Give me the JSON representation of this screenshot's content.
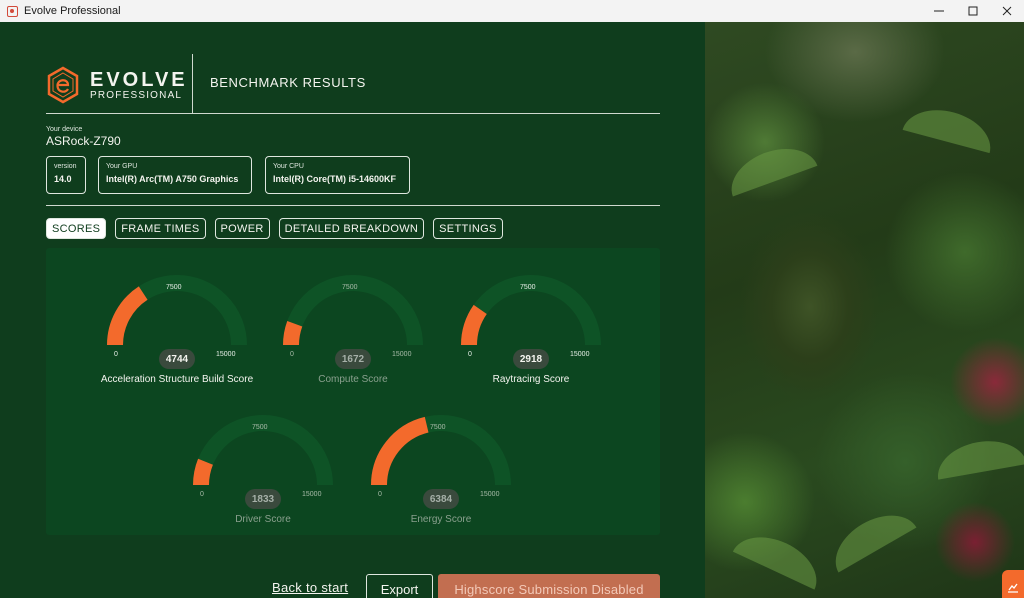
{
  "window": {
    "title": "Evolve Professional"
  },
  "brand": {
    "name": "EVOLVE",
    "sub": "PROFESSIONAL",
    "section_title": "BENCHMARK RESULTS",
    "accent": "#f36a2c"
  },
  "device": {
    "label": "Your device",
    "name": "ASRock-Z790"
  },
  "info": {
    "version": {
      "label": "version",
      "value": "14.0"
    },
    "gpu": {
      "label": "Your GPU",
      "value": "Intel(R) Arc(TM) A750 Graphics"
    },
    "cpu": {
      "label": "Your CPU",
      "value": "Intel(R) Core(TM) i5-14600KF"
    }
  },
  "tabs": [
    {
      "label": "SCORES",
      "active": true
    },
    {
      "label": "FRAME TIMES",
      "active": false
    },
    {
      "label": "POWER",
      "active": false
    },
    {
      "label": "DETAILED BREAKDOWN",
      "active": false
    },
    {
      "label": "SETTINGS",
      "active": false
    }
  ],
  "gauge_scale": {
    "min": "0",
    "mid": "7500",
    "max": "15000",
    "max_value": 15000
  },
  "gauges": [
    {
      "label": "Acceleration Structure Build Score",
      "value": 4744,
      "value_text": "4744",
      "enabled": true
    },
    {
      "label": "Compute Score",
      "value": 1672,
      "value_text": "1672",
      "enabled": false
    },
    {
      "label": "Raytracing Score",
      "value": 2918,
      "value_text": "2918",
      "enabled": true
    },
    {
      "label": "Driver Score",
      "value": 1833,
      "value_text": "1833",
      "enabled": false
    },
    {
      "label": "Energy Score",
      "value": 6384,
      "value_text": "6384",
      "enabled": false
    }
  ],
  "footer": {
    "back_label": "Back to start",
    "export_label": "Export",
    "highscore_label": "Highscore Submission Disabled"
  }
}
